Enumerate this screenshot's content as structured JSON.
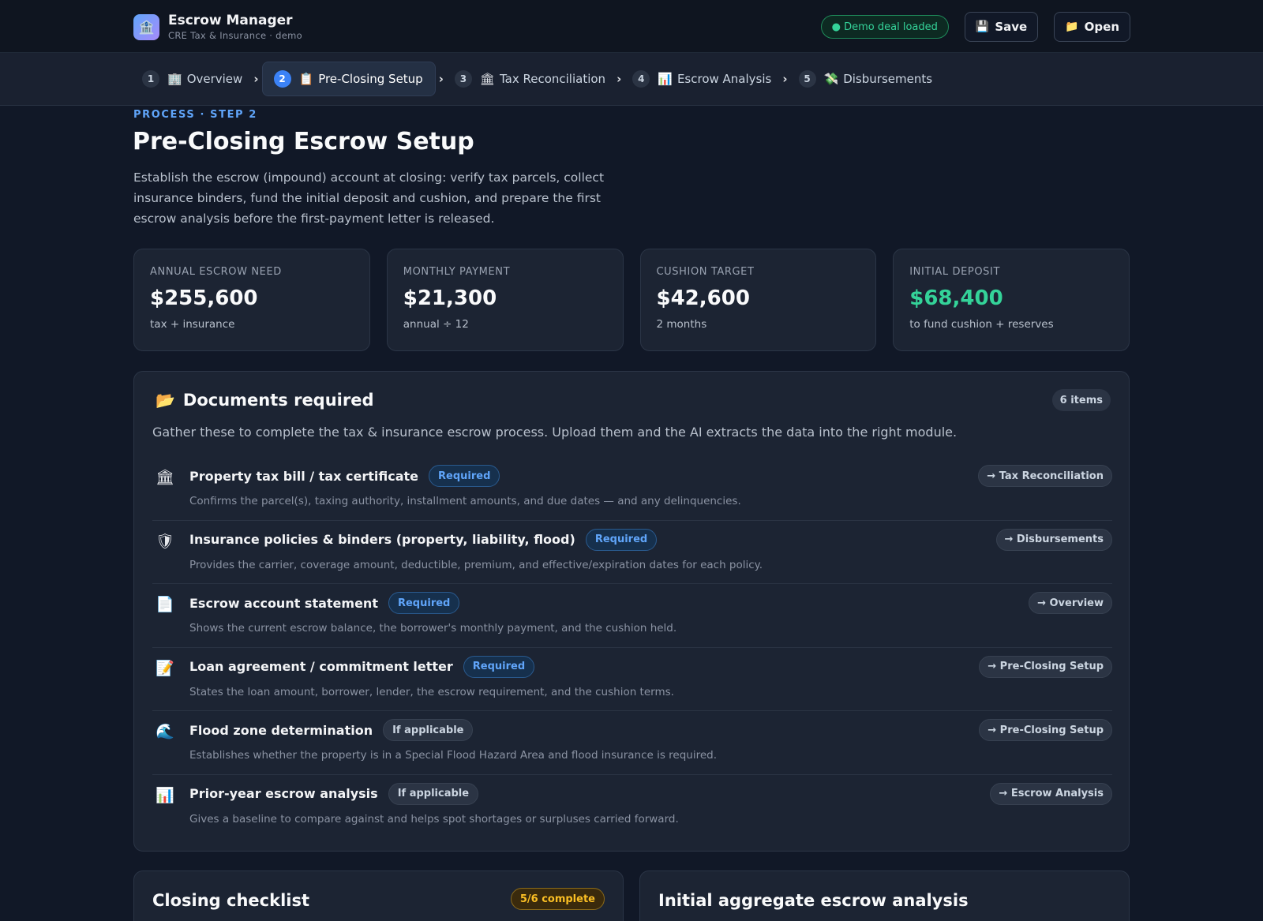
{
  "header": {
    "app_title": "Escrow Manager",
    "app_subtitle": "CRE Tax & Insurance · demo",
    "logo_icon": "bank-icon",
    "status_text": "● Demo deal loaded",
    "save_label": "Save",
    "open_label": "Open",
    "accent": "#3b82f6"
  },
  "steps": [
    {
      "num": "1",
      "icon": "🏢",
      "label": "Overview",
      "active": false
    },
    {
      "num": "2",
      "icon": "📋",
      "label": "Pre-Closing Setup",
      "active": true
    },
    {
      "num": "3",
      "icon": "🏛",
      "label": "Tax Reconciliation",
      "active": false
    },
    {
      "num": "4",
      "icon": "📊",
      "label": "Escrow Analysis",
      "active": false
    },
    {
      "num": "5",
      "icon": "💸",
      "label": "Disbursements",
      "active": false
    }
  ],
  "intro": {
    "eyebrow": "PROCESS · STEP 2",
    "title": "Pre-Closing Escrow Setup",
    "description": "Establish the escrow (impound) account at closing: verify tax parcels, collect insurance binders, fund the initial deposit and cushion, and prepare the first escrow analysis before the first-payment letter is released."
  },
  "stats": [
    {
      "label": "ANNUAL ESCROW NEED",
      "value": "$255,600",
      "sub": "tax + insurance"
    },
    {
      "label": "MONTHLY PAYMENT",
      "value": "$21,300",
      "sub": "annual ÷ 12"
    },
    {
      "label": "CUSHION TARGET",
      "value": "$42,600",
      "sub": "2 months"
    },
    {
      "label": "INITIAL DEPOSIT",
      "value": "$68,400",
      "sub": "to fund cushion + reserves"
    }
  ],
  "documents": {
    "title": "Documents required",
    "count": "6 items",
    "description": "Gather these to complete the tax & insurance escrow process. Upload them and the AI extracts the data into the right module.",
    "items": [
      {
        "icon": "🏛",
        "title": "Property tax bill / tax certificate",
        "badge": "Required",
        "desc": "Confirms the parcel(s), taxing authority, installment amounts, and due dates — and any delinquencies.",
        "route": "→ Tax Reconciliation"
      },
      {
        "icon": "🛡",
        "title": "Insurance policies & binders (property, liability, flood)",
        "badge": "Required",
        "desc": "Provides the carrier, coverage amount, deductible, premium, and effective/expiration dates for each policy.",
        "route": "→ Disbursements"
      },
      {
        "icon": "📄",
        "title": "Escrow account statement",
        "badge": "Required",
        "desc": "Shows the current escrow balance, the borrower's monthly payment, and the cushion held.",
        "route": "→ Overview"
      },
      {
        "icon": "📝",
        "title": "Loan agreement / commitment letter",
        "badge": "Required",
        "desc": "States the loan amount, borrower, lender, the escrow requirement, and the cushion terms.",
        "route": "→ Pre-Closing Setup"
      },
      {
        "icon": "🌊",
        "title": "Flood zone determination",
        "badge": "If applicable",
        "desc": "Establishes whether the property is in a Special Flood Hazard Area and flood insurance is required.",
        "route": "→ Pre-Closing Setup"
      },
      {
        "icon": "📊",
        "title": "Prior-year escrow analysis",
        "badge": "If applicable",
        "desc": "Gives a baseline to compare against and helps spot shortages or surpluses carried forward.",
        "route": "→ Escrow Analysis"
      }
    ]
  },
  "checklist": {
    "title": "Closing checklist",
    "status": "5/6 complete"
  },
  "analysis": {
    "title": "Initial aggregate escrow analysis"
  }
}
